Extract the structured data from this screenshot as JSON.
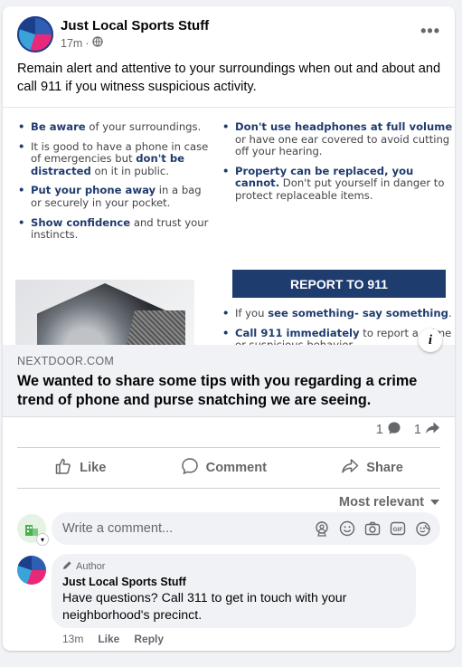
{
  "post": {
    "page_name": "Just Local Sports Stuff",
    "timestamp": "17m",
    "separator": "·",
    "privacy_icon": "globe-icon",
    "more_icon": "more-options-icon",
    "text": "Remain alert and attentive to your surroundings when out and about and call 911 if you witness suspicious activity."
  },
  "link_preview": {
    "tips_left": [
      {
        "bold": "Be aware",
        "rest": " of your surroundings."
      },
      {
        "pre": "It is good to have a phone in case of emergencies but ",
        "bold": "don't be distracted",
        "rest": " on it in public."
      },
      {
        "bold": "Put your phone away",
        "rest": " in a bag or securely in your pocket."
      },
      {
        "bold": "Show confidence",
        "rest": " and trust your instincts."
      }
    ],
    "tips_right": [
      {
        "bold": "Don't use headphones at full volume",
        "rest": " or have one ear covered to avoid cutting off your hearing."
      },
      {
        "bold": "Property can be replaced, you cannot.",
        "rest": " Don't put yourself in danger to protect replaceable items."
      }
    ],
    "report_label": "REPORT TO 911",
    "tips_bottom": [
      {
        "pre": "If you ",
        "bold": "see something- say something",
        "rest": "."
      },
      {
        "bold": "Call 911 immediately",
        "rest": " to report a crime or suspicious behavior."
      }
    ],
    "info_icon": "i",
    "domain": "NEXTDOOR.COM",
    "title": "We wanted to share some tips with you regarding a crime trend of phone and purse snatching we are seeing."
  },
  "counts": {
    "comments": "1",
    "shares": "1"
  },
  "actions": {
    "like": "Like",
    "comment": "Comment",
    "share": "Share"
  },
  "sort": {
    "label": "Most relevant"
  },
  "compose": {
    "placeholder": "Write a comment..."
  },
  "comment": {
    "badge": "Author",
    "name": "Just Local Sports Stuff",
    "text": "Have questions? Call 311 to get in touch with your neighborhood's precinct.",
    "time": "13m",
    "like": "Like",
    "reply": "Reply"
  },
  "colors": {
    "accent": "#1f3c6e",
    "muted": "#65676b"
  }
}
